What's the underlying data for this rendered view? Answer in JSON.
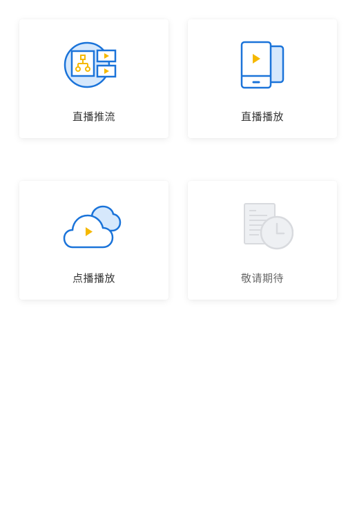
{
  "cards": [
    {
      "label": "直播推流",
      "icon": "live-push-icon",
      "enabled": true
    },
    {
      "label": "直播播放",
      "icon": "live-play-icon",
      "enabled": true
    },
    {
      "label": "点播播放",
      "icon": "vod-play-icon",
      "enabled": true
    },
    {
      "label": "敬请期待",
      "icon": "coming-soon-icon",
      "enabled": false
    }
  ],
  "colors": {
    "primary_blue": "#1a73d9",
    "light_blue_fill": "#d6e8fc",
    "accent_yellow": "#f5b800",
    "disabled_gray": "#d8dade",
    "disabled_fill": "#eef0f3"
  }
}
